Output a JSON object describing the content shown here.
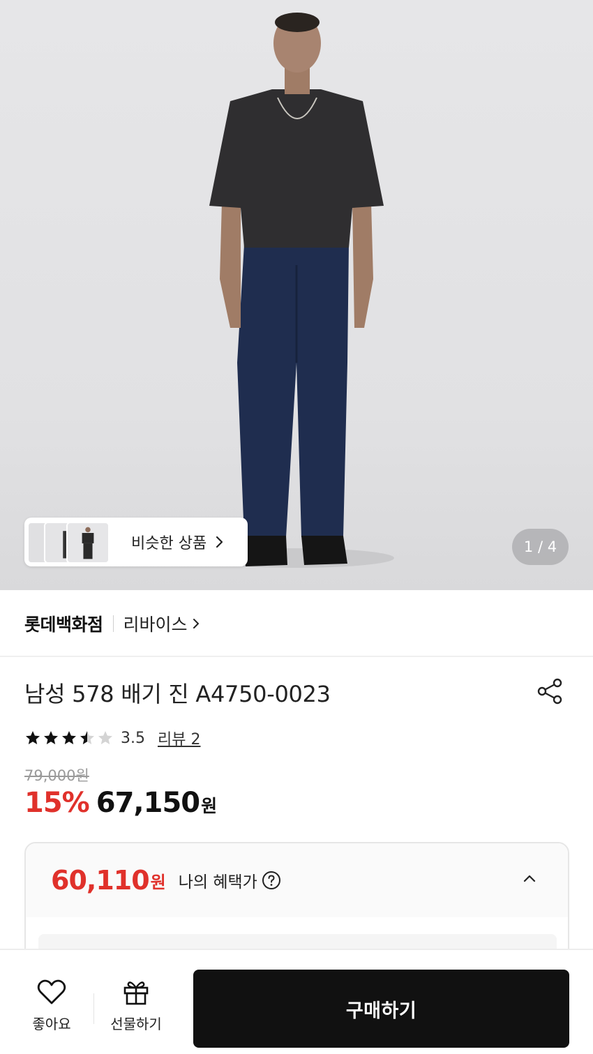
{
  "hero": {
    "page_current": "1",
    "page_total": "4",
    "page_indicator": "1 / 4",
    "similar_label": "비슷한 상품"
  },
  "brand": {
    "store_name": "롯데백화점",
    "brand_name": "리바이스"
  },
  "product": {
    "title": "남성 578 배기 진 A4750-0023",
    "rating": 3.5,
    "rating_text": "3.5",
    "stars_max": 5,
    "review_link": "리뷰 2",
    "original_price": "79,000원",
    "discount_rate": "15%",
    "sale_price": "67,150",
    "sale_unit": "원"
  },
  "benefit": {
    "price": "60,110",
    "unit": "원",
    "label": "나의 혜택가"
  },
  "bottom_bar": {
    "like_label": "좋아요",
    "gift_label": "선물하기",
    "buy_label": "구매하기"
  },
  "colors": {
    "accent_red": "#e0312b",
    "buy_button": "#111111"
  },
  "icons": [
    "chevron-right-icon",
    "share-icon",
    "star-icon",
    "help-icon",
    "chevron-up-icon",
    "heart-icon",
    "gift-icon"
  ]
}
